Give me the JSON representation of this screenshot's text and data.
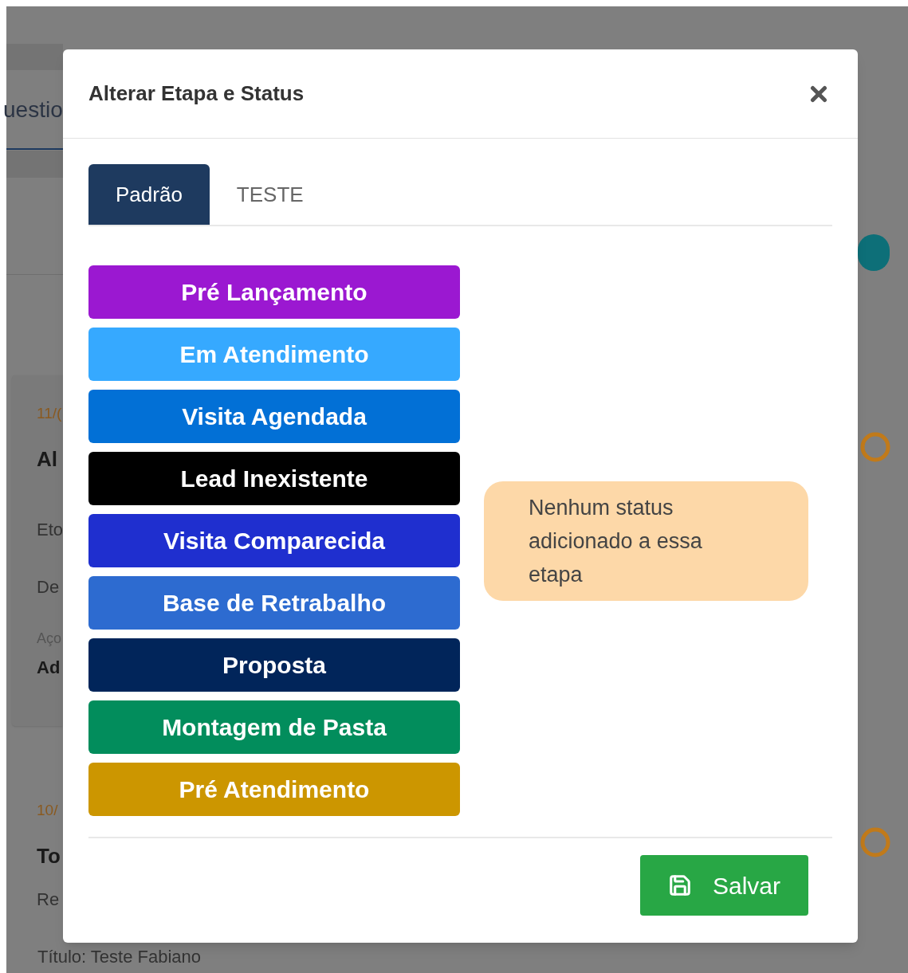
{
  "background": {
    "tab_fragment": "uestio",
    "cards": [
      {
        "date": "11/(",
        "title": "Al",
        "lines": [
          "Eto",
          "De"
        ],
        "label": "Aço",
        "value": "Ad"
      },
      {
        "date": "10/",
        "title": "To",
        "lines": [
          "Re"
        ]
      }
    ],
    "footer_text": "Título: Teste Fabiano"
  },
  "modal": {
    "title": "Alterar Etapa e Status",
    "tabs": [
      {
        "label": "Padrão",
        "selected": true
      },
      {
        "label": "TESTE",
        "selected": false
      }
    ],
    "stages": [
      {
        "label": "Pré Lançamento",
        "color": "#9b18d1"
      },
      {
        "label": "Em Atendimento",
        "color": "#36a9ff"
      },
      {
        "label": "Visita Agendada",
        "color": "#0270d6"
      },
      {
        "label": "Lead Inexistente",
        "color": "#000000"
      },
      {
        "label": "Visita Comparecida",
        "color": "#1f2fcf"
      },
      {
        "label": "Base de Retrabalho",
        "color": "#2d6bd0"
      },
      {
        "label": "Proposta",
        "color": "#01255a"
      },
      {
        "label": "Montagem de Pasta",
        "color": "#028d5c"
      },
      {
        "label": "Pré Atendimento",
        "color": "#cc9600"
      }
    ],
    "note": "Nenhum status adicionado a essa etapa",
    "save_button": "Salvar"
  }
}
